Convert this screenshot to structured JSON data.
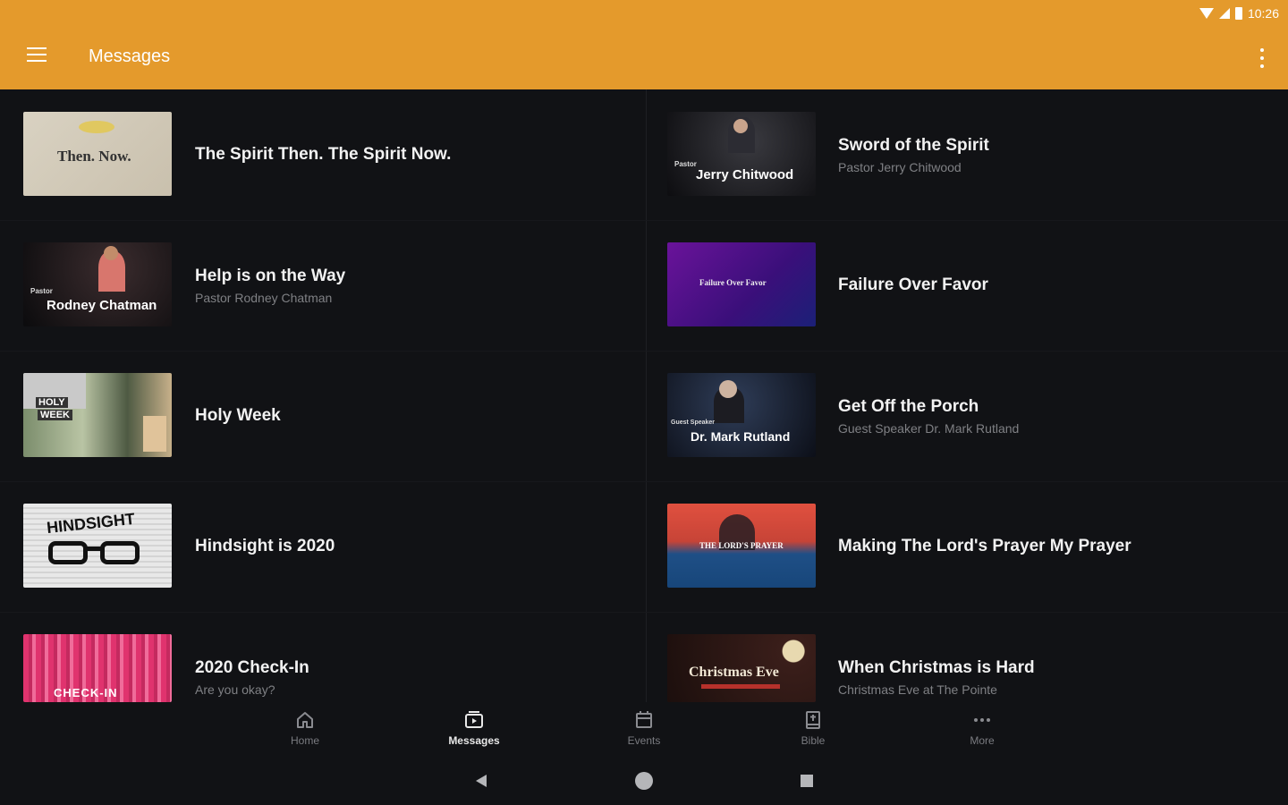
{
  "status": {
    "time": "10:26"
  },
  "appbar": {
    "title": "Messages"
  },
  "messages": [
    {
      "title": "The Spirit Then. The Spirit Now.",
      "subtitle": ""
    },
    {
      "title": "Sword of the Spirit",
      "subtitle": "Pastor Jerry Chitwood"
    },
    {
      "title": "Help is on the Way",
      "subtitle": "Pastor Rodney Chatman"
    },
    {
      "title": "Failure Over Favor",
      "subtitle": ""
    },
    {
      "title": "Holy Week",
      "subtitle": ""
    },
    {
      "title": "Get Off the Porch",
      "subtitle": "Guest Speaker Dr. Mark Rutland"
    },
    {
      "title": "Hindsight is 2020",
      "subtitle": ""
    },
    {
      "title": "Making The Lord's Prayer My Prayer",
      "subtitle": ""
    },
    {
      "title": "2020 Check-In",
      "subtitle": "Are you okay?"
    },
    {
      "title": "When Christmas is Hard",
      "subtitle": "Christmas Eve at The Pointe"
    }
  ],
  "thumbs": {
    "t0": "Then. Now.",
    "t1a": "Pastor",
    "t1b": "Jerry Chitwood",
    "t2a": "Pastor",
    "t2b": "Rodney Chatman",
    "t3": "Failure Over Favor",
    "t4a": "HOLY",
    "t4b": "WEEK",
    "t5a": "Guest Speaker",
    "t5b": "Dr. Mark Rutland",
    "t6": "HINDSIGHT",
    "t7": "THE LORD'S PRAYER",
    "t8": "CHECK-IN",
    "t9": "Christmas Eve"
  },
  "nav": [
    {
      "label": "Home",
      "icon": "home-icon"
    },
    {
      "label": "Messages",
      "icon": "messages-icon"
    },
    {
      "label": "Events",
      "icon": "calendar-icon"
    },
    {
      "label": "Bible",
      "icon": "bible-icon"
    },
    {
      "label": "More",
      "icon": "more-icon"
    }
  ],
  "colors": {
    "accent": "#e49a2c",
    "background": "#111215"
  }
}
